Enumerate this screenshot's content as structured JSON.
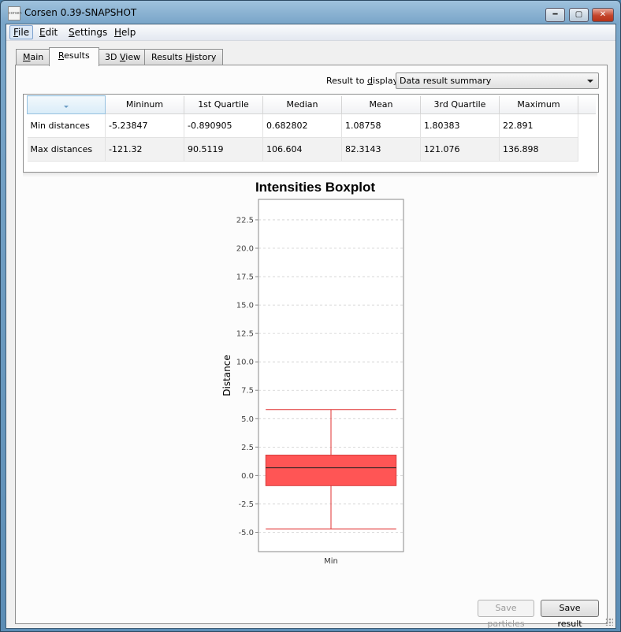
{
  "window": {
    "title": "Corsen 0.39-SNAPSHOT",
    "icon_label": "corsen"
  },
  "menubar": {
    "items": [
      {
        "label": "File",
        "mnemonic": "F",
        "rest": "ile"
      },
      {
        "label": "Edit",
        "mnemonic": "E",
        "rest": "dit"
      },
      {
        "label": "Settings",
        "mnemonic": "S",
        "rest": "ettings"
      },
      {
        "label": "Help",
        "mnemonic": "H",
        "rest": "elp"
      }
    ]
  },
  "tabs": [
    {
      "label": "Main",
      "mnemonic": "M",
      "rest": "ain",
      "selected": false
    },
    {
      "label": "Results",
      "mnemonic": "R",
      "rest": "esults",
      "selected": true
    },
    {
      "label": "3D View",
      "pre": "3D ",
      "mnemonic": "V",
      "rest": "iew",
      "selected": false
    },
    {
      "label": "Results History",
      "pre": "Results ",
      "mnemonic": "H",
      "rest": "istory",
      "selected": false
    }
  ],
  "results": {
    "display_label_pre": "Result to ",
    "display_label_mnemonic": "d",
    "display_label_rest": "isplay:",
    "display_value": "Data result summary",
    "table": {
      "columns": [
        "",
        "Mininum",
        "1st Quartile",
        "Median",
        "Mean",
        "3rd Quartile",
        "Maximum"
      ],
      "rows": [
        [
          "Min distances",
          "-5.23847",
          "-0.890905",
          "0.682802",
          "1.08758",
          "1.80383",
          "22.891"
        ],
        [
          "Max distances",
          "-121.32",
          "90.5119",
          "106.604",
          "82.3143",
          "121.076",
          "136.898"
        ]
      ]
    },
    "buttons": {
      "save_particles": "Save particles",
      "save_result": "Save result"
    }
  },
  "colors": {
    "box_fill": "#ff5555",
    "whisker": "#e03030",
    "median_line": "#222222"
  },
  "chart_data": {
    "type": "boxplot",
    "title": "Intensities Boxplot",
    "xlabel": "",
    "ylabel": "Distance",
    "ylim": [
      -6.7,
      24.3
    ],
    "yticks": [
      -5.0,
      -2.5,
      0.0,
      2.5,
      5.0,
      7.5,
      10.0,
      12.5,
      15.0,
      17.5,
      20.0,
      22.5
    ],
    "grid": true,
    "categories": [
      "Min"
    ],
    "boxes": [
      {
        "category": "Min",
        "whisker_low": -4.7,
        "q1": -0.9,
        "median": 0.68,
        "q3": 1.8,
        "whisker_high": 5.8
      }
    ]
  }
}
